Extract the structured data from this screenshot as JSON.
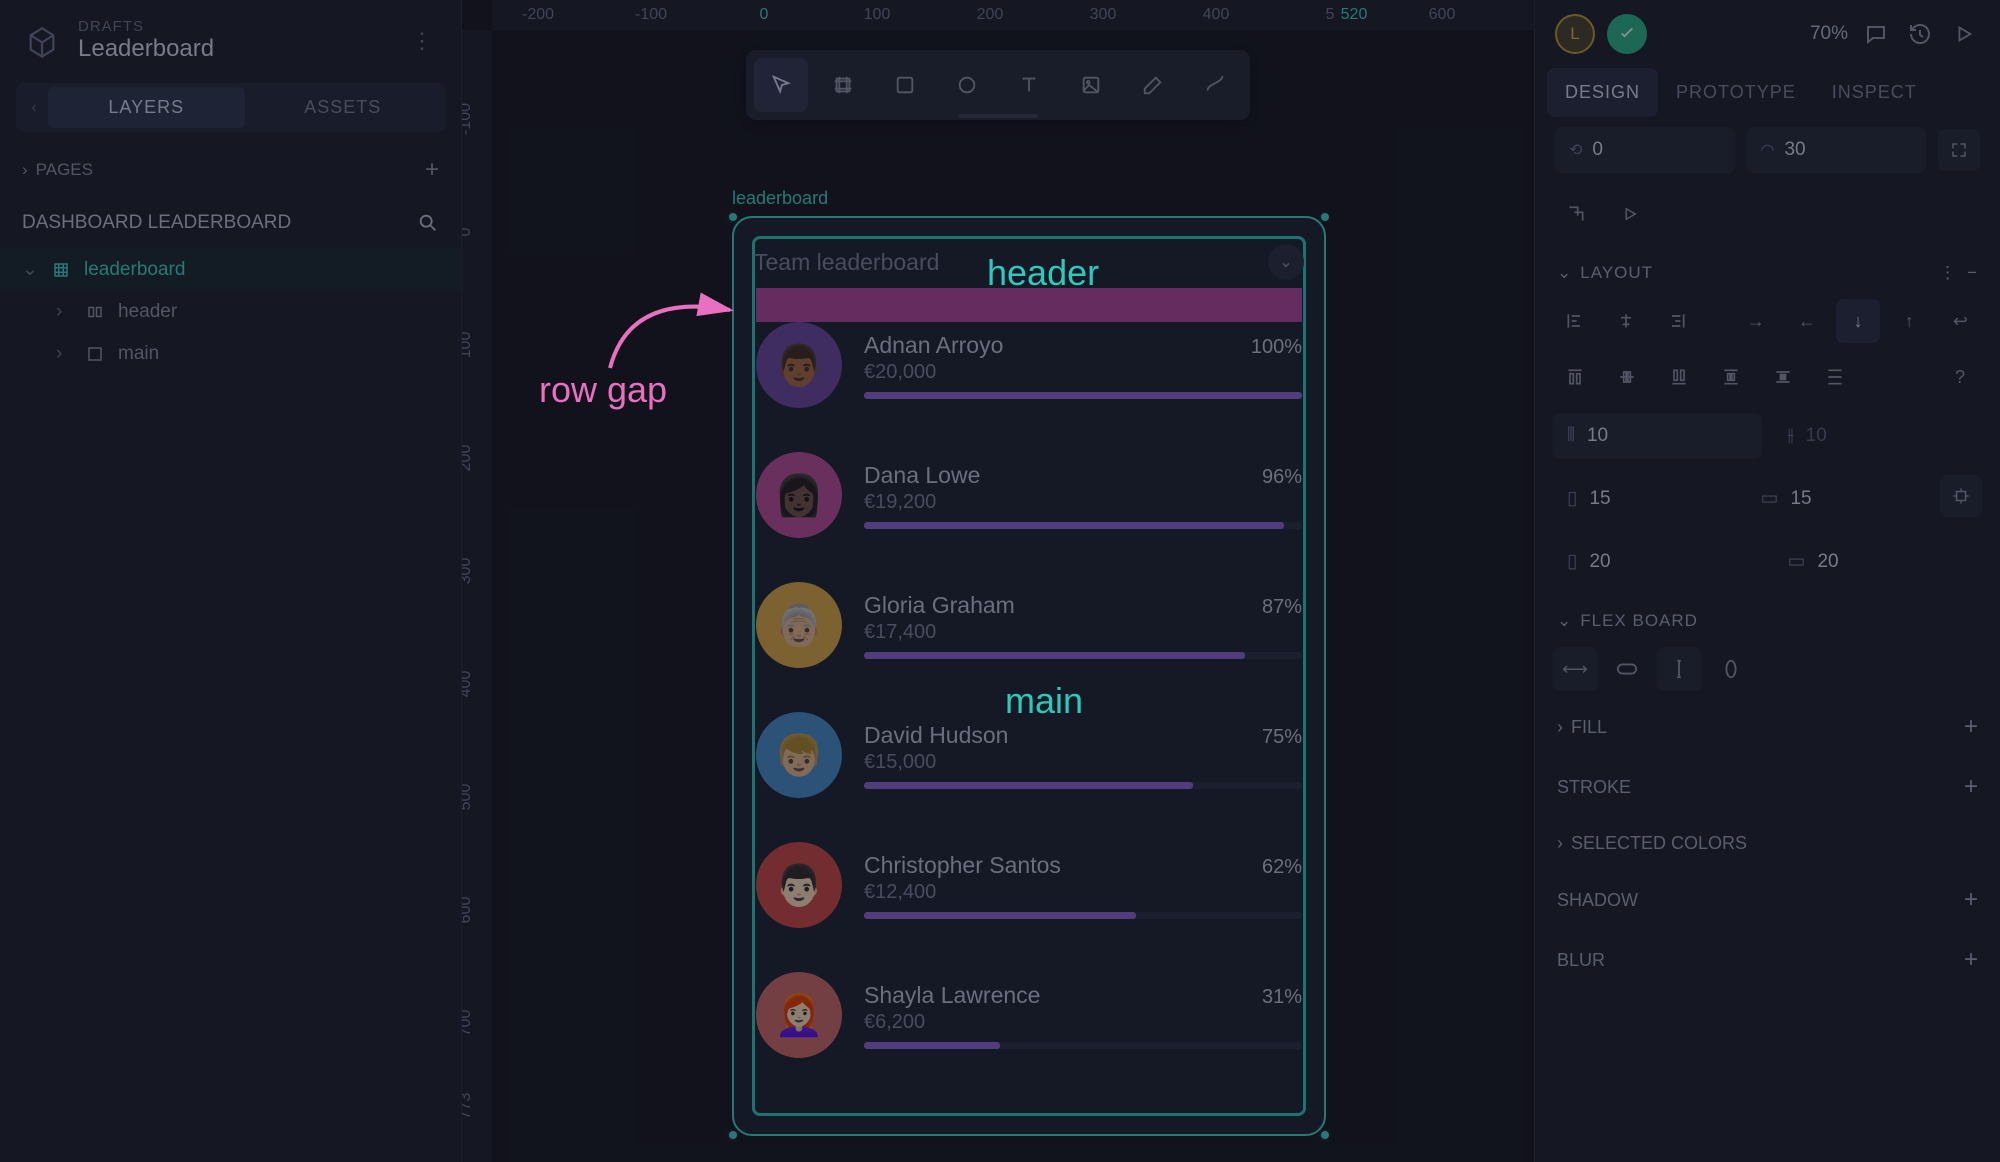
{
  "doc": {
    "drafts": "DRAFTS",
    "title": "Leaderboard"
  },
  "left": {
    "tabs": {
      "layers": "LAYERS",
      "assets": "ASSETS"
    },
    "pages": "PAGES",
    "file": "DASHBOARD LEADERBOARD",
    "tree": {
      "root": "leaderboard",
      "children": [
        "header",
        "main"
      ]
    }
  },
  "ruler_h": {
    "m200": "-200",
    "m100": "-100",
    "z": "0",
    "p100": "100",
    "p200": "200",
    "p300": "300",
    "p400": "400",
    "p500": "5",
    "p520": "520",
    "p600": "600"
  },
  "ruler_v": {
    "m100": "-100",
    "z": "0",
    "p100": "100",
    "p200": "200",
    "p300": "300",
    "p400": "400",
    "p500": "500",
    "p600": "600",
    "p700": "700",
    "p773": "773"
  },
  "frame_label": "leaderboard",
  "card": {
    "title": "Team leaderboard",
    "entries": [
      {
        "name": "Adnan Arroyo",
        "value": "€20,000",
        "pct": "100%",
        "bar": 100,
        "bg": "#6b4aa0",
        "emoji": "👨🏾"
      },
      {
        "name": "Dana Lowe",
        "value": "€19,200",
        "pct": "96%",
        "bar": 96,
        "bg": "#b84f9a",
        "emoji": "👩🏿"
      },
      {
        "name": "Gloria Graham",
        "value": "€17,400",
        "pct": "87%",
        "bar": 87,
        "bg": "#d9a84a",
        "emoji": "👵🏼"
      },
      {
        "name": "David Hudson",
        "value": "€15,000",
        "pct": "75%",
        "bar": 75,
        "bg": "#4a8cc9",
        "emoji": "👦🏼"
      },
      {
        "name": "Christopher Santos",
        "value": "€12,400",
        "pct": "62%",
        "bar": 62,
        "bg": "#c94a4a",
        "emoji": "👨🏻"
      },
      {
        "name": "Shayla Lawrence",
        "value": "€6,200",
        "pct": "31%",
        "bar": 31,
        "bg": "#c96b6b",
        "emoji": "👩🏻‍🦰"
      }
    ]
  },
  "overlay": {
    "header": "header",
    "main": "main",
    "rowgap": "row gap"
  },
  "right": {
    "zoom": "70%",
    "tabs": {
      "design": "DESIGN",
      "prototype": "PROTOTYPE",
      "inspect": "INSPECT"
    },
    "rotation": "0",
    "radius": "30",
    "sections": {
      "layout": "LAYOUT",
      "flex": "FLEX BOARD",
      "fill": "FILL",
      "stroke": "STROKE",
      "sel_colors": "SELECTED COLORS",
      "shadow": "SHADOW",
      "blur": "BLUR"
    },
    "spacing": {
      "row_gap": "10",
      "col_gap": "10",
      "pad_v": "15",
      "pad_h": "15",
      "margin_v": "20",
      "margin_h": "20"
    }
  }
}
